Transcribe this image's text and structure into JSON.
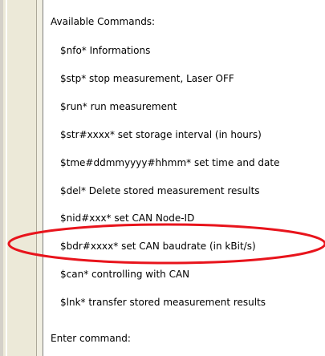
{
  "console": {
    "header": "Available Commands:",
    "commands": [
      "$nfo*  Informations",
      "$stp*  stop measurement, Laser OFF",
      "$run*  run measurement",
      "$str#xxxx*  set storage interval (in hours)",
      "$tme#ddmmyyyy#hhmm*  set time and date",
      "$del*  Delete stored measurement results",
      "$nid#xxx*  set CAN Node-ID",
      "$bdr#xxxx*  set CAN baudrate (in kBit/s)",
      "$can*  controlling with CAN",
      "$lnk*  transfer stored measurement results"
    ],
    "prompt": "Enter command:"
  },
  "annotation": {
    "highlight_color": "#e8141c",
    "highlighted_command_index": 7
  }
}
